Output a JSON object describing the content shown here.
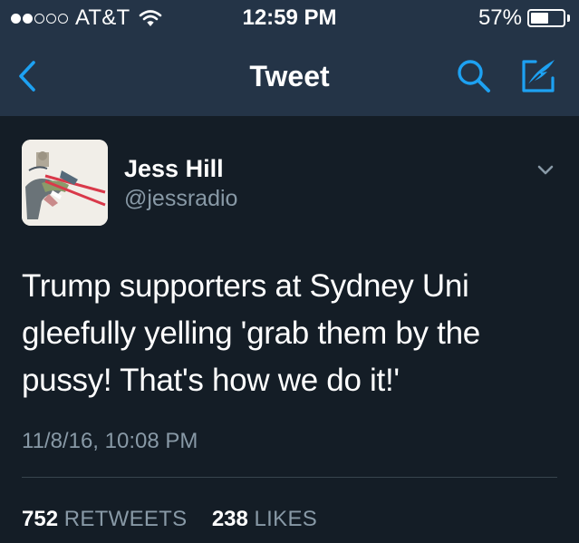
{
  "status_bar": {
    "signal_bars_filled": 2,
    "signal_bars_total": 5,
    "carrier": "AT&T",
    "time": "12:59 PM",
    "battery_percent": "57%",
    "battery_level": 0.57
  },
  "nav": {
    "title": "Tweet",
    "back_icon": "chevron-left-icon",
    "search_icon": "search-icon",
    "compose_icon": "compose-icon",
    "accent_color": "#1da1f2"
  },
  "tweet": {
    "author_name": "Jess Hill",
    "author_handle": "@jessradio",
    "text_lines": [
      "Trump supporters at Sydney Uni",
      "gleefully yelling 'grab them by the",
      "pussy! That's how we do it!'"
    ],
    "timestamp": "11/8/16, 10:08 PM",
    "stats": {
      "retweets_count": "752",
      "retweets_label": "RETWEETS",
      "likes_count": "238",
      "likes_label": "LIKES"
    }
  },
  "colors": {
    "background": "#141d26",
    "chrome": "#243447",
    "secondary_text": "#8899a6",
    "divider": "#38444d"
  }
}
